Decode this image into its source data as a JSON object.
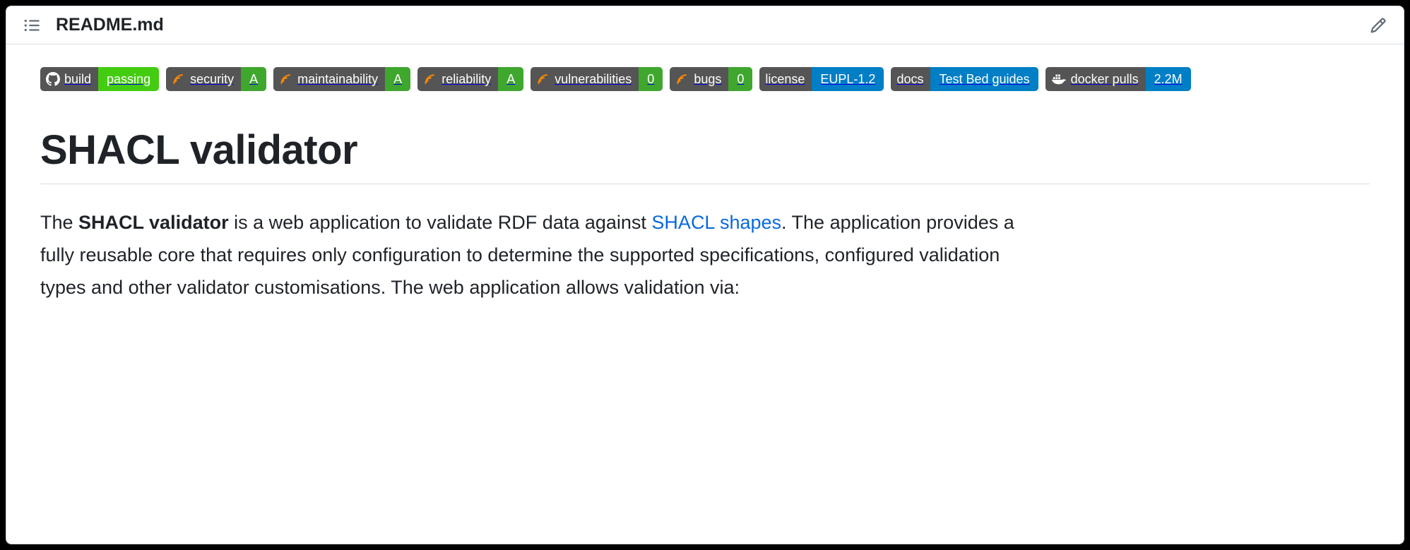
{
  "filename": "README.md",
  "badges": [
    {
      "icon": "github",
      "label": "build",
      "value": "passing",
      "color": "green"
    },
    {
      "icon": "sonar",
      "label": "security",
      "value": "A",
      "color": "green-dark"
    },
    {
      "icon": "sonar",
      "label": "maintainability",
      "value": "A",
      "color": "green-dark"
    },
    {
      "icon": "sonar",
      "label": "reliability",
      "value": "A",
      "color": "green-dark"
    },
    {
      "icon": "sonar",
      "label": "vulnerabilities",
      "value": "0",
      "color": "green-dark"
    },
    {
      "icon": "sonar",
      "label": "bugs",
      "value": "0",
      "color": "green-dark"
    },
    {
      "icon": "",
      "label": "license",
      "value": "EUPL-1.2",
      "color": "blue"
    },
    {
      "icon": "",
      "label": "docs",
      "value": "Test Bed guides",
      "color": "blue"
    },
    {
      "icon": "docker",
      "label": "docker pulls",
      "value": "2.2M",
      "color": "blue"
    }
  ],
  "title": "SHACL validator",
  "intro": {
    "pre": "The ",
    "strong": "SHACL validator",
    "mid": " is a web application to validate RDF data against ",
    "link": "SHACL shapes",
    "post": ". The application provides a fully reusable core that requires only configuration to determine the supported specifications, configured validation types and other validator customisations. The web application allows validation via:"
  }
}
